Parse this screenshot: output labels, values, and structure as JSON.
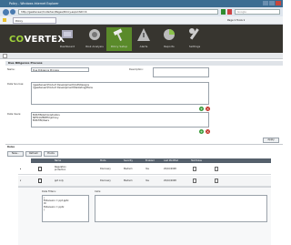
{
  "browser": {
    "window_title": "Policy - Windows Internet Explorer",
    "url": "http://gesitenser/CoVertex/Pages/Policy.aspx?AID=4",
    "search_placeholder": "Google",
    "tab_label": "Policy",
    "toolbar_right": "Page ▾ Tools ▾"
  },
  "app": {
    "logo_prefix": "CO",
    "logo_rest": "VERTEX",
    "nav": [
      {
        "label": "Dashboard",
        "icon": "dashboard-icon"
      },
      {
        "label": "Risk Analysis",
        "icon": "risk-analysis-icon"
      },
      {
        "label": "Policy Setup",
        "icon": "hammer-icon",
        "active": true
      },
      {
        "label": "Alerts",
        "icon": "alert-triangle-icon"
      },
      {
        "label": "Reports",
        "icon": "reports-icon"
      },
      {
        "label": "Settings",
        "icon": "wrench-icon"
      }
    ],
    "accent": "#9fd23a",
    "header_bg": "#37352f"
  },
  "policy": {
    "section_title": "Due Diligence Process",
    "name_label": "Name:",
    "name_value": "Due Diligence Process",
    "description_label": "Description:",
    "data_sources_label": "Data Sources:",
    "data_sources": [
      "\\\\gesitenser\\Product Development\\CAD\\Designs",
      "\\\\gesitenser\\Product Development\\Marketing\\Plans"
    ],
    "data_users_label": "Data Users:",
    "data_users": [
      "BUILTIN\\Administrators",
      "NETCOVERTEX\\Johnny",
      "BUILTIN\\Users"
    ],
    "apply_label": "Apply"
  },
  "rules": {
    "title": "Rules",
    "toolbar": {
      "new": "New...",
      "refresh": "Refresh",
      "pivots": "Pivots"
    },
    "columns": [
      "Name",
      "Mode",
      "Severity",
      "Enabled",
      "Last Modified",
      "Test Rules"
    ],
    "rows": [
      {
        "name": "Regulation protection",
        "mode": "Discovery",
        "severity": "Medium",
        "enabled": "Yes",
        "modified": "29/10/2008"
      },
      {
        "name": "ppt only",
        "mode": "Discovery",
        "severity": "Medium",
        "enabled": "Yes",
        "modified": "29/10/2008"
      }
    ],
    "detail": {
      "data_filters_label": "Data Filters:",
      "filters": [
        "(",
        "Extension = ppt.pptx",
        "Or",
        "Extension = pptx",
        ")"
      ],
      "cells_label": "Cells:"
    }
  }
}
